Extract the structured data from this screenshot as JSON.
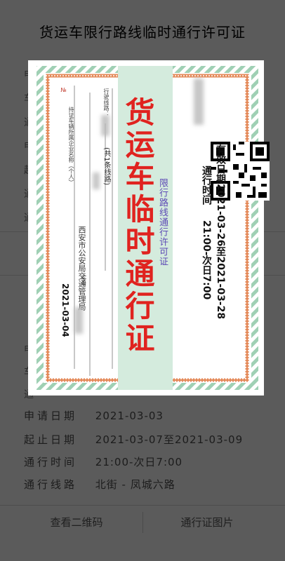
{
  "header": {
    "title": "货运车限行路线临时通行许可证"
  },
  "details": [
    {
      "label": "申请日期",
      "value": "2021-03-03"
    },
    {
      "label": "起止日期",
      "value": "2021-03-07至2021-03-09"
    },
    {
      "label": "通行时间",
      "value": "21:00-次日7:00"
    },
    {
      "label": "通行线路",
      "value": "北街 - 凤城六路"
    }
  ],
  "bottom_actions": {
    "qr_label": "查看二维码",
    "permit_label": "通行证图片"
  },
  "permit": {
    "title": "货运车临时通行证",
    "subtitle": "限行路线通行许可证",
    "validity": "有效日期2021-03-26至2021-03-28",
    "time_label": "通行时间",
    "time_value": "21:00-次日7:00",
    "route_label": "行驶线路：",
    "owner_label": "持证车辆所属企业名称（个人）",
    "route_count": "(共1条线路)",
    "authority": "西安市公安局交通管理局",
    "plate_label": "车号",
    "no_label": "№",
    "issue_date": "2021-03-04"
  },
  "colors": {
    "overlay": "#5b5b5b",
    "red": "#e0231f",
    "green": "#cfe8d9",
    "purple": "#5d4ab5"
  }
}
